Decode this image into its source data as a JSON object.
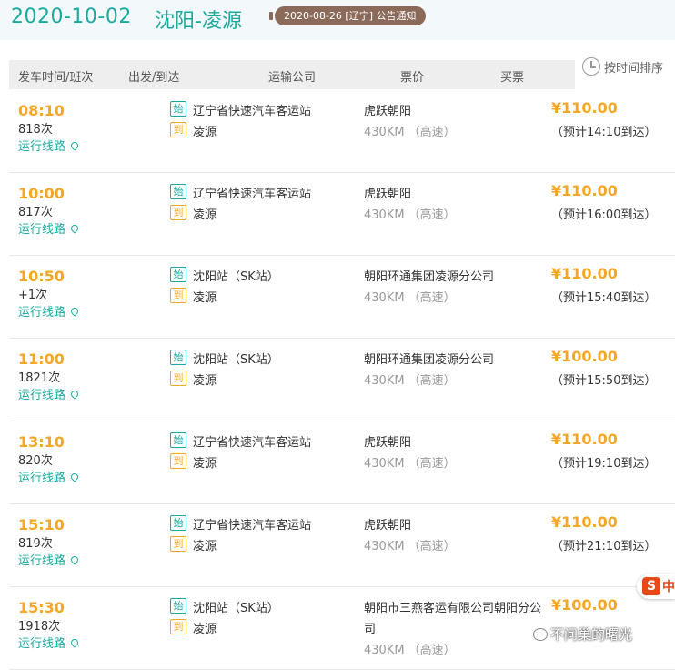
{
  "route": {
    "date": "2020-10-02",
    "name": "沈阳-凌源",
    "notice": "2020-08-26 [辽宁] 公告通知"
  },
  "header": {
    "col_time": "发车时间/班次",
    "col_route": "出发/到达",
    "col_company": "运输公司",
    "col_price": "票价",
    "col_buy": "买票",
    "sort_label": "按时间排序"
  },
  "labels": {
    "start_tag": "始",
    "end_tag": "到",
    "route_link": "运行线路"
  },
  "trips": [
    {
      "time": "08:10",
      "number": "818次",
      "from": "辽宁省快速汽车客运站",
      "to": "凌源",
      "company": "虎跃朝阳",
      "distance": "430KM （高速）",
      "price": "¥110.00",
      "arrival": "（预计14:10到达）"
    },
    {
      "time": "10:00",
      "number": "817次",
      "from": "辽宁省快速汽车客运站",
      "to": "凌源",
      "company": "虎跃朝阳",
      "distance": "430KM （高速）",
      "price": "¥110.00",
      "arrival": "（预计16:00到达）"
    },
    {
      "time": "10:50",
      "number": "+1次",
      "from": "沈阳站（SK站）",
      "to": "凌源",
      "company": "朝阳环通集团凌源分公司",
      "distance": "430KM （高速）",
      "price": "¥110.00",
      "arrival": "（预计15:40到达）"
    },
    {
      "time": "11:00",
      "number": "1821次",
      "from": "沈阳站（SK站）",
      "to": "凌源",
      "company": "朝阳环通集团凌源分公司",
      "distance": "430KM （高速）",
      "price": "¥100.00",
      "arrival": "（预计15:50到达）"
    },
    {
      "time": "13:10",
      "number": "820次",
      "from": "辽宁省快速汽车客运站",
      "to": "凌源",
      "company": "虎跃朝阳",
      "distance": "430KM （高速）",
      "price": "¥110.00",
      "arrival": "（预计19:10到达）"
    },
    {
      "time": "15:10",
      "number": "819次",
      "from": "辽宁省快速汽车客运站",
      "to": "凌源",
      "company": "虎跃朝阳",
      "distance": "430KM （高速）",
      "price": "¥110.00",
      "arrival": "（预计21:10到达）"
    },
    {
      "time": "15:30",
      "number": "1918次",
      "from": "沈阳站（SK站）",
      "to": "凌源",
      "company": "朝阳市三燕客运有限公司朝阳分公司",
      "distance": "430KM （高速）",
      "price": "¥100.00",
      "arrival": ""
    }
  ],
  "overlay": {
    "sogou_s": "S",
    "sogou_text": "中",
    "watermark": "不问巢的曙光"
  }
}
